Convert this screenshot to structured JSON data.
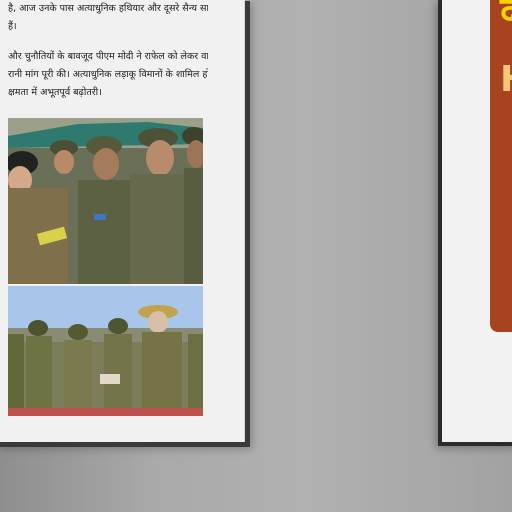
{
  "article": {
    "line_1": "है, आज उनके पास अत्याधुनिक हथियार और दूसरे सैन्य साजो",
    "line_2": "हैं।",
    "line_3": "और चुनौतियों के बावजूद पीएम मोदी ने राफेल को लेकर वायु",
    "line_4": "रानी मांग पूरी की। अत्याधुनिक लड़ाकू विमानों के शामिल होने",
    "line_5": "क्षमता में अभूतपूर्व बढ़ोतरी।"
  },
  "right_card": {
    "glyph_top": "द",
    "glyph_mid": "H"
  },
  "colors": {
    "accent_red": "#c0504d",
    "card_orange": "#a8431f",
    "card_yellow": "#f5d400"
  }
}
